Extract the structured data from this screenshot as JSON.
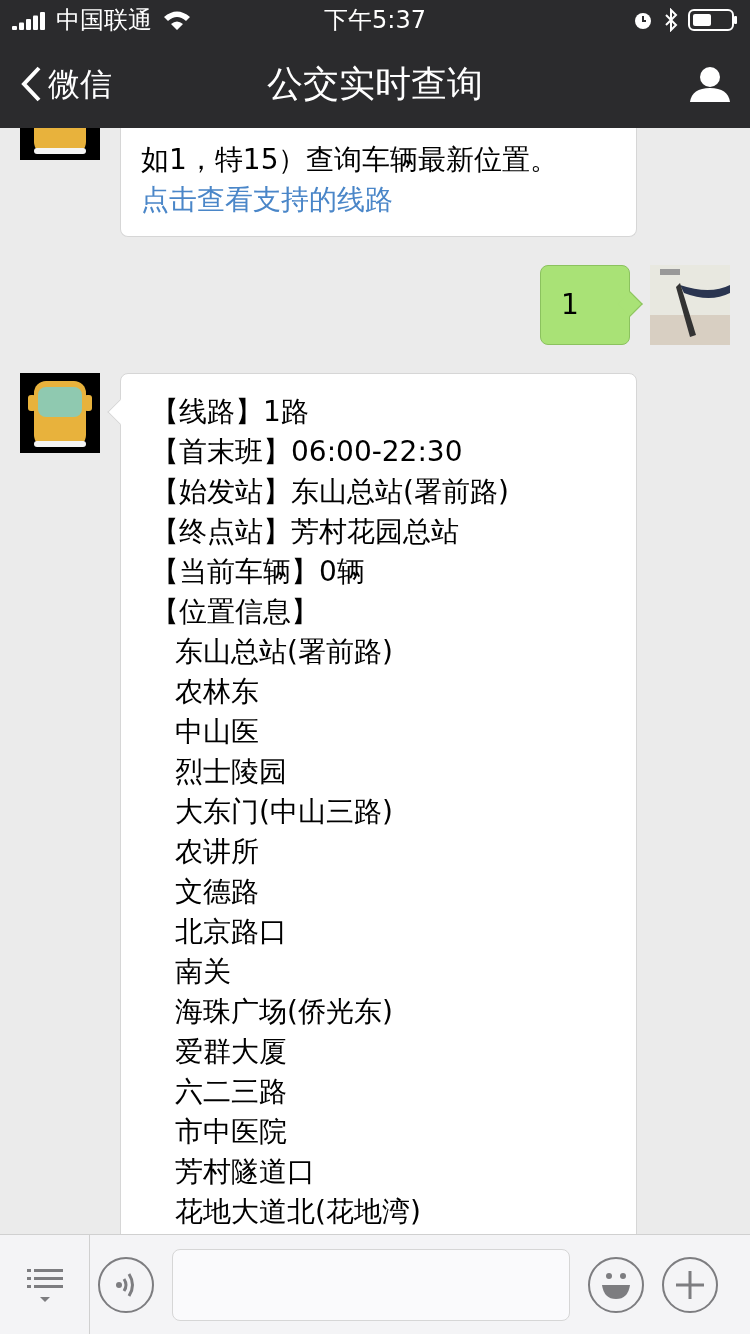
{
  "status_bar": {
    "carrier": "中国联通",
    "time": "下午5:37"
  },
  "nav": {
    "back": "微信",
    "title": "公交实时查询"
  },
  "messages": [
    {
      "kind": "bot_partial",
      "lines": [
        "如1，特15）查询车辆最新位置。"
      ],
      "link": "点击查看支持的线路"
    },
    {
      "kind": "user",
      "text": "1"
    },
    {
      "kind": "bot",
      "fields": [
        {
          "text": "【线路】1路"
        },
        {
          "text": "【首末班】06:00-22:30"
        },
        {
          "text": "【始发站】东山总站(署前路)"
        },
        {
          "text": "【终点站】芳村花园总站"
        },
        {
          "text": "【当前车辆】0辆"
        },
        {
          "text": "【位置信息】",
          "children": [
            {
              "text": "东山总站(署前路)"
            },
            {
              "text": "农林东"
            },
            {
              "text": "中山医"
            },
            {
              "text": "烈士陵园"
            },
            {
              "text": "大东门(中山三路)"
            },
            {
              "text": "农讲所"
            },
            {
              "text": "文德路"
            },
            {
              "text": "北京路口"
            },
            {
              "text": "南关"
            },
            {
              "text": "海珠广场(侨光东)"
            },
            {
              "text": "爱群大厦"
            },
            {
              "text": "六二三路"
            },
            {
              "text": "市中医院"
            },
            {
              "text": "芳村隧道口"
            },
            {
              "text": "花地大道北(花地湾)"
            }
          ]
        }
      ]
    }
  ]
}
